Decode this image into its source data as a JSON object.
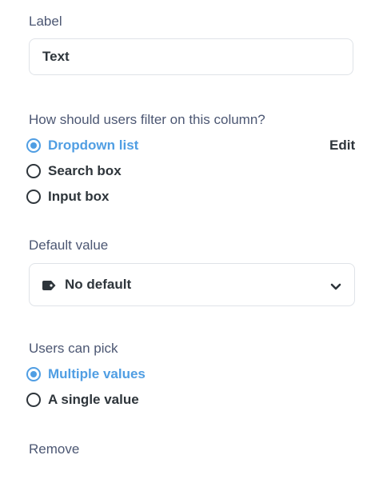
{
  "label_section": {
    "heading": "Label",
    "input_value": "Text"
  },
  "filter_section": {
    "heading": "How should users filter on this column?",
    "edit_label": "Edit",
    "options": [
      {
        "label": "Dropdown list",
        "selected": true
      },
      {
        "label": "Search box",
        "selected": false
      },
      {
        "label": "Input box",
        "selected": false
      }
    ]
  },
  "default_section": {
    "heading": "Default value",
    "select_value": "No default",
    "icons": {
      "tag": "tag-icon",
      "dropdown": "chevron-down-icon"
    }
  },
  "pick_section": {
    "heading": "Users can pick",
    "options": [
      {
        "label": "Multiple values",
        "selected": true
      },
      {
        "label": "A single value",
        "selected": false
      }
    ]
  },
  "remove_label": "Remove",
  "colors": {
    "accent": "#509ee3",
    "text_dark": "#2e353b",
    "text_medium": "#4c5773",
    "border": "#dfe3e8"
  }
}
